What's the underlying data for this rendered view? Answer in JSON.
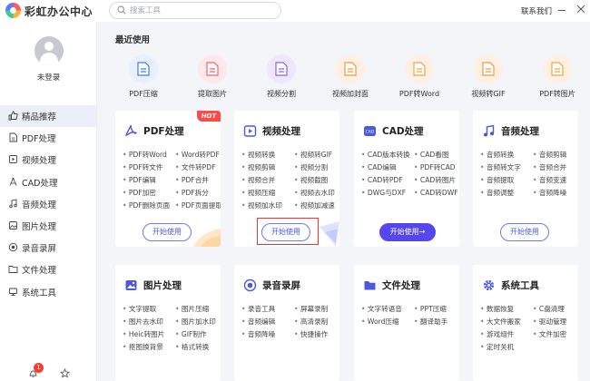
{
  "app": {
    "title": "彩虹办公中心",
    "contact": "联系我们"
  },
  "search": {
    "placeholder": "搜索工具"
  },
  "sidebar": {
    "login": "未登录",
    "badge": "1",
    "items": [
      {
        "label": "精品推荐",
        "icon": "thumbs-up-icon"
      },
      {
        "label": "PDF处理",
        "icon": "pdf-icon"
      },
      {
        "label": "视频处理",
        "icon": "video-icon"
      },
      {
        "label": "CAD处理",
        "icon": "cad-icon"
      },
      {
        "label": "音频处理",
        "icon": "music-icon"
      },
      {
        "label": "图片处理",
        "icon": "image-icon"
      },
      {
        "label": "录音录屏",
        "icon": "record-icon"
      },
      {
        "label": "文件处理",
        "icon": "folder-icon"
      },
      {
        "label": "系统工具",
        "icon": "system-icon"
      }
    ]
  },
  "recent": {
    "title": "最近使用",
    "items": [
      {
        "label": "PDF压缩",
        "color": "#e7f0ff",
        "accent": "#3f7df0"
      },
      {
        "label": "提取图片",
        "color": "#ffe8ea",
        "accent": "#f06070"
      },
      {
        "label": "视频分割",
        "color": "#efe7ff",
        "accent": "#8a63e8"
      },
      {
        "label": "视频加封面",
        "color": "#fff0e3",
        "accent": "#f0963f"
      },
      {
        "label": "PDF转Word",
        "color": "#fff0e3",
        "accent": "#f0a43f"
      },
      {
        "label": "视频转GIF",
        "color": "#fff0e3",
        "accent": "#f0963f"
      },
      {
        "label": "PDF转图片",
        "color": "#fff0e3",
        "accent": "#f0a43f"
      }
    ]
  },
  "cards": [
    {
      "title": "PDF处理",
      "hot": "HOT",
      "button": "开始使用",
      "features": [
        "PDF转Word",
        "Word转PDF",
        "PDF转文件",
        "文件转PDF",
        "PDF编辑",
        "PDF合并",
        "PDF加密",
        "PDF拆分",
        "PDF删除页面",
        "PDF页面提取"
      ]
    },
    {
      "title": "视频处理",
      "button": "开始使用",
      "features": [
        "视频转换",
        "视频转GIF",
        "视频剪辑",
        "视频分割",
        "视频合并",
        "视频截图",
        "视频压缩",
        "视频去水印",
        "视频加水印",
        "视频加减速"
      ]
    },
    {
      "title": "CAD处理",
      "button": "开始使用→",
      "features": [
        "CAD版本转换",
        "CAD看图",
        "CAD编辑",
        "PDF转CAD",
        "CAD转PDF",
        "CAD转图片",
        "DWG与DXF",
        "CAD转DWF"
      ]
    },
    {
      "title": "音频处理",
      "button": "开始使用",
      "features": [
        "音频转换",
        "音频剪辑",
        "音频转文字",
        "音频合并",
        "音频提取",
        "音频变速",
        "音频调整",
        "音频降噪"
      ]
    },
    {
      "title": "图片处理",
      "features": [
        "文字提取",
        "图片压缩",
        "图片去水印",
        "图片加水印",
        "Heic转图片",
        "GIF制作",
        "抠图换背景",
        "格式转换"
      ]
    },
    {
      "title": "录音录屏",
      "features": [
        "录音工具",
        "屏幕录制",
        "音频编辑",
        "高清录制",
        "音频降噪",
        "快捷操作"
      ]
    },
    {
      "title": "文件处理",
      "features": [
        "文字转语音",
        "PPT压缩",
        "Word压缩",
        "翻译助手"
      ]
    },
    {
      "title": "系统工具",
      "features": [
        "数据恢复",
        "C盘清理",
        "大文件搬家",
        "驱动管理",
        "游戏组件",
        "文件加密",
        "定时关机"
      ]
    }
  ]
}
